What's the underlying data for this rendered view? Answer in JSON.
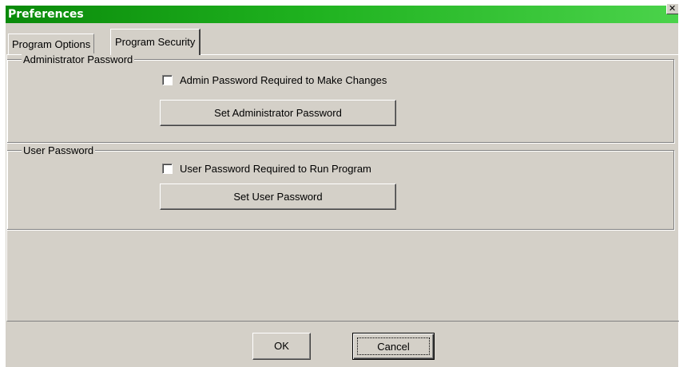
{
  "window": {
    "title": "Preferences",
    "close_glyph": "✕",
    "titlebar_color": "#1fb21f",
    "face_color": "#d4d0c8"
  },
  "tabs": [
    {
      "label": "Program Options",
      "active": false
    },
    {
      "label": "Program Security",
      "active": true
    }
  ],
  "admin_group": {
    "legend": "Administrator Password",
    "checkbox_label": "Admin Password Required to Make Changes",
    "checked": false,
    "button_label": "Set Administrator Password"
  },
  "user_group": {
    "legend": "User Password",
    "checkbox_label": "User Password Required to Run Program",
    "checked": false,
    "button_label": "Set User Password"
  },
  "footer": {
    "ok_label": "OK",
    "cancel_label": "Cancel"
  }
}
